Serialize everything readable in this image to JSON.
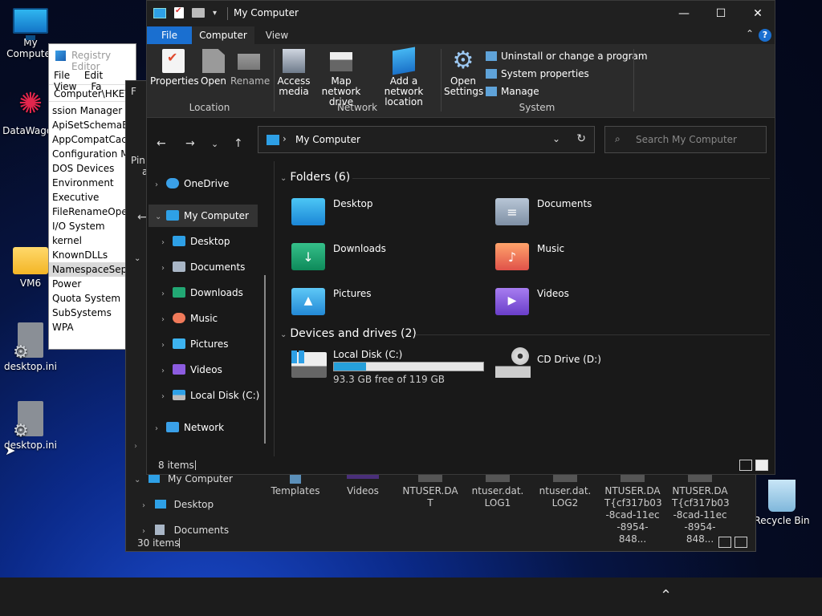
{
  "desktop": {
    "icons": [
      {
        "label": "My Computer",
        "icon": "monitor-icon"
      },
      {
        "label": "DataWagon",
        "icon": "datawagon-icon"
      },
      {
        "label": "VM6",
        "icon": "folder-icon"
      },
      {
        "label": "desktop.ini",
        "icon": "settings-file-icon"
      },
      {
        "label": "desktop.ini",
        "icon": "settings-file-icon"
      },
      {
        "label": "Recycle Bin",
        "icon": "recycle-bin-icon"
      }
    ]
  },
  "regedit": {
    "title": "Registry Editor",
    "menu": [
      "File",
      "Edit",
      "View",
      "Fa"
    ],
    "address": "Computer\\HKEY_",
    "keys": [
      "ssion Manager",
      "ApiSetSchemaExt",
      "AppCompatCach",
      "Configuration Ma",
      "DOS Devices",
      "Environment",
      "Executive",
      "FileRenameOpera",
      "I/O System",
      "kernel",
      "KnownDLLs",
      "NamespaceSepar",
      "Power",
      "Quota System",
      "SubSystems",
      "WPA"
    ],
    "selected_index": 11
  },
  "back_window": {
    "nav": [
      "My Computer",
      "Desktop",
      "Documents"
    ],
    "files": [
      {
        "name": "Templates"
      },
      {
        "name": "Videos"
      },
      {
        "name": "NTUSER.DA T"
      },
      {
        "name": "ntuser.dat. LOG1"
      },
      {
        "name": "ntuser.dat. LOG2"
      },
      {
        "name": "NTUSER.DA T{cf317b03 -8cad-11ec -8954-848..."
      },
      {
        "name": "NTUSER.DA T{cf317b03 -8cad-11ec -8954-848..."
      }
    ],
    "status": "30 items",
    "side_letters": [
      "F",
      "Pin",
      "a"
    ]
  },
  "window": {
    "title": "My Computer",
    "controls": {
      "minimize": "—",
      "maximize": "☐",
      "close": "✕"
    },
    "tabs": {
      "file": "File",
      "computer": "Computer",
      "view": "View"
    },
    "ribbon": {
      "location": {
        "label": "Location",
        "properties": "Properties",
        "open": "Open",
        "rename": "Rename"
      },
      "network": {
        "label": "Network",
        "access_media": "Access media",
        "map_drive": "Map network drive",
        "add_location": "Add a network location"
      },
      "system": {
        "label": "System",
        "open_settings": "Open Settings",
        "uninstall": "Uninstall or change a program",
        "system_properties": "System properties",
        "manage": "Manage"
      }
    },
    "address": {
      "path": "My Computer"
    },
    "search": {
      "placeholder": "Search My Computer"
    },
    "nav": {
      "onedrive": "OneDrive",
      "my_computer": "My Computer",
      "desktop": "Desktop",
      "documents": "Documents",
      "downloads": "Downloads",
      "music": "Music",
      "pictures": "Pictures",
      "videos": "Videos",
      "local_disk": "Local Disk (C:)",
      "network": "Network"
    },
    "folders": {
      "header": "Folders (6)",
      "items": [
        "Desktop",
        "Documents",
        "Downloads",
        "Music",
        "Pictures",
        "Videos"
      ]
    },
    "drives": {
      "header": "Devices and drives (2)",
      "local": {
        "name": "Local Disk (C:)",
        "free_text": "93.3 GB free of 119 GB",
        "used_fraction": 0.216
      },
      "cd": {
        "name": "CD Drive (D:)"
      }
    },
    "status": "8 items"
  }
}
